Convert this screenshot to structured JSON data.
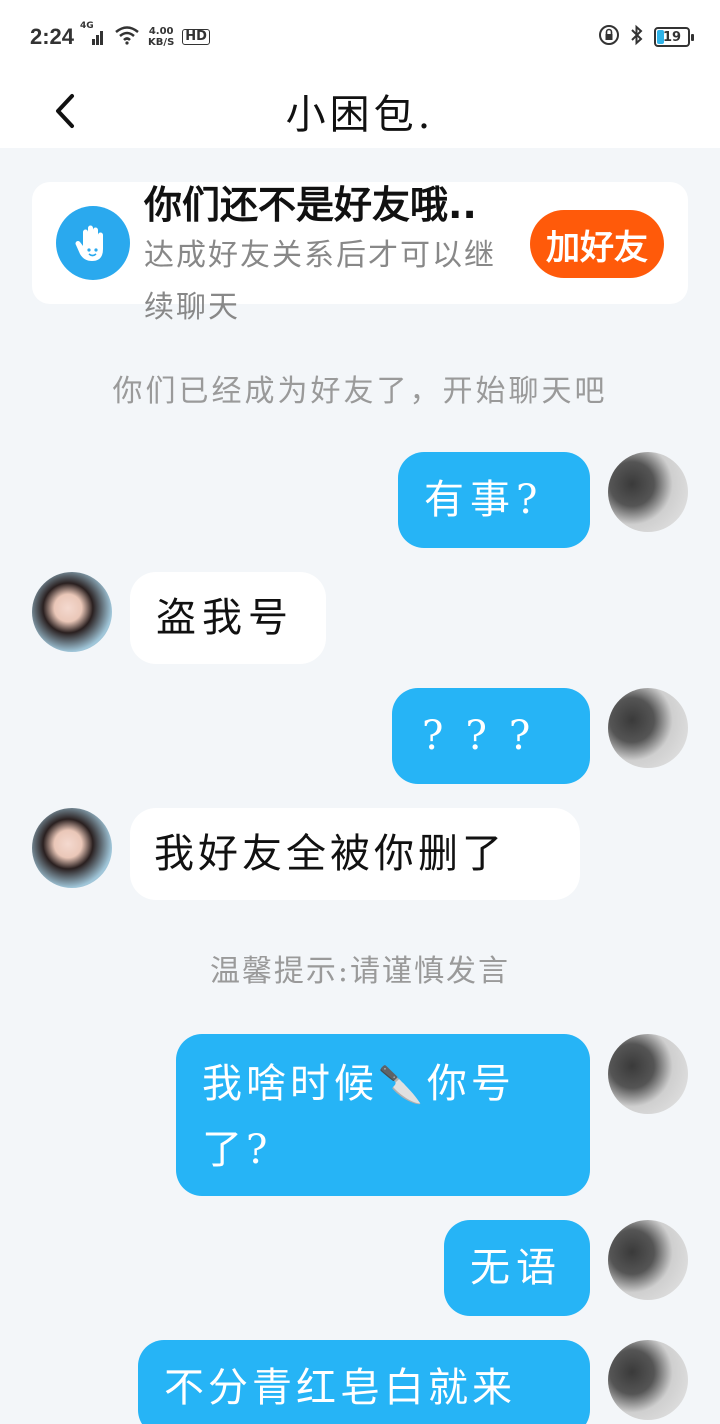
{
  "status_bar": {
    "time": "2:24",
    "network": "4G",
    "speed_value": "4.00",
    "speed_unit": "KB/S",
    "hd": "HD",
    "battery": "19",
    "icons": [
      "signal-icon",
      "wifi-icon",
      "lock-rotation-icon",
      "bluetooth-icon",
      "battery-icon"
    ]
  },
  "header": {
    "title": "小困包.",
    "back_icon": "chevron-left-icon"
  },
  "friend_banner": {
    "title": "你们还不是好友哦..",
    "description": "达成好友关系后才可以继续聊天",
    "add_button": "加好友",
    "icon": "hand-icon"
  },
  "notices": {
    "became_friends": "你们已经成为好友了，开始聊天吧",
    "warning": "温馨提示:请谨慎发言"
  },
  "messages": [
    {
      "sender": "me",
      "text": "有事?"
    },
    {
      "sender": "them",
      "text": "盗我号"
    },
    {
      "sender": "me",
      "text": "???"
    },
    {
      "sender": "them",
      "text": "我好友全被你删了"
    },
    {
      "sender": "me",
      "text_before": "我啥时候",
      "emoji": "🔪",
      "text_after": "你号了?"
    },
    {
      "sender": "me",
      "text": "无语"
    },
    {
      "sender": "me",
      "text": "不分青红皂白就来"
    }
  ],
  "colors": {
    "my_bubble": "#26b4f6",
    "their_bubble": "#ffffff",
    "add_button": "#ff5a0a",
    "banner_icon": "#2aa9ee",
    "background": "#f3f6f9"
  }
}
